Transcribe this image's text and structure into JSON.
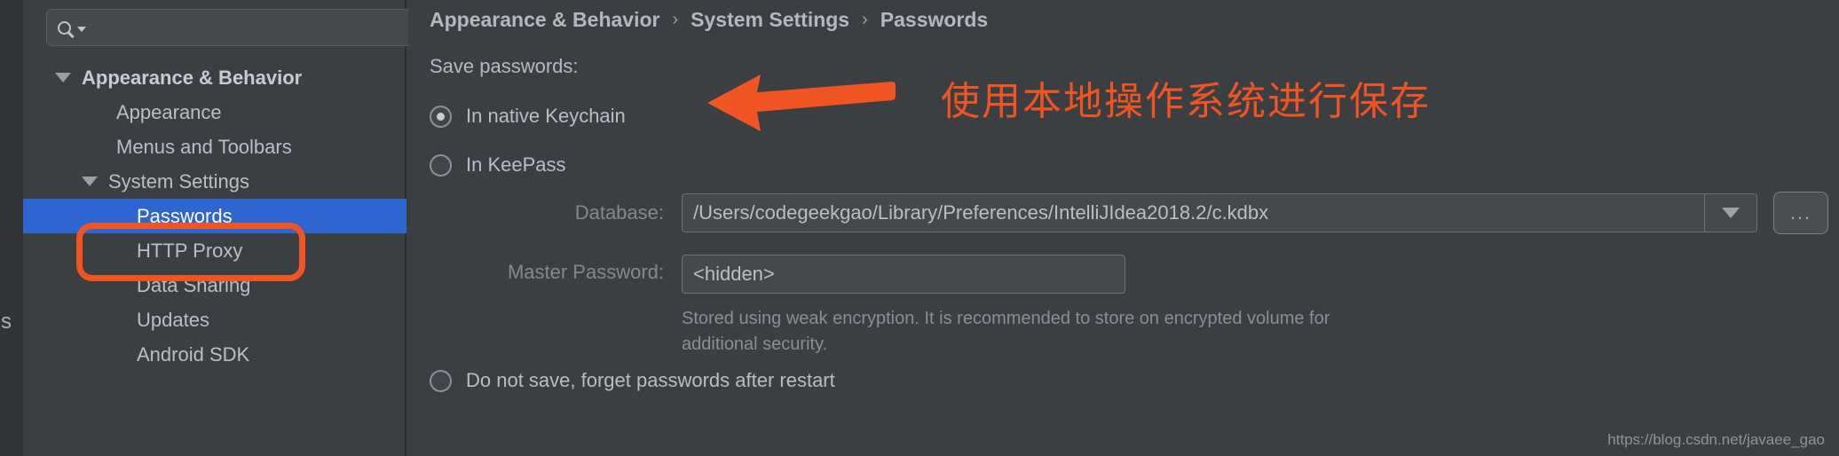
{
  "window": {
    "background_color": "#3c3f41",
    "accent_selection_color": "#2f65d0",
    "annotation_color": "#f05423"
  },
  "behind_window": {
    "fragment_1": "s"
  },
  "sidebar": {
    "search": {
      "value": "",
      "placeholder": "",
      "icon": "search-icon",
      "dropdown_icon": "caret-down-icon"
    },
    "items": [
      {
        "label": "Appearance & Behavior",
        "depth": 0,
        "expanded": true,
        "bold": true,
        "selected": false
      },
      {
        "label": "Appearance",
        "depth": 1,
        "expanded": null,
        "bold": false,
        "selected": false
      },
      {
        "label": "Menus and Toolbars",
        "depth": 1,
        "expanded": null,
        "bold": false,
        "selected": false
      },
      {
        "label": "System Settings",
        "depth": 1,
        "expanded": true,
        "bold": false,
        "selected": false
      },
      {
        "label": "Passwords",
        "depth": 2,
        "expanded": null,
        "bold": false,
        "selected": true
      },
      {
        "label": "HTTP Proxy",
        "depth": 2,
        "expanded": null,
        "bold": false,
        "selected": false
      },
      {
        "label": "Data Sharing",
        "depth": 2,
        "expanded": null,
        "bold": false,
        "selected": false
      },
      {
        "label": "Updates",
        "depth": 2,
        "expanded": null,
        "bold": false,
        "selected": false
      },
      {
        "label": "Android SDK",
        "depth": 2,
        "expanded": null,
        "bold": false,
        "selected": false
      }
    ]
  },
  "content": {
    "breadcrumb": {
      "items": [
        "Appearance & Behavior",
        "System Settings",
        "Passwords"
      ],
      "separator": "›"
    },
    "save_passwords_label": "Save passwords:",
    "options": [
      {
        "label": "In native Keychain",
        "selected": true
      },
      {
        "label": "In KeePass",
        "selected": false
      },
      {
        "label": "Do not save, forget passwords after restart",
        "selected": false
      }
    ],
    "database": {
      "label": "Database:",
      "value": "/Users/codegeekgao/Library/Preferences/IntelliJIdea2018.2/c.kdbx",
      "dropdown_icon": "caret-down-icon",
      "browse_button_label": "..."
    },
    "master_password": {
      "label": "Master Password:",
      "value": "<hidden>"
    },
    "hint": "Stored using weak encryption. It is recommended to store on encrypted volume for additional security."
  },
  "annotations": {
    "arrow_icon": "arrow-left-icon",
    "note_text": "使用本地操作系统进行保存",
    "highlight_target": "Passwords"
  },
  "watermark": "https://blog.csdn.net/javaee_gao"
}
